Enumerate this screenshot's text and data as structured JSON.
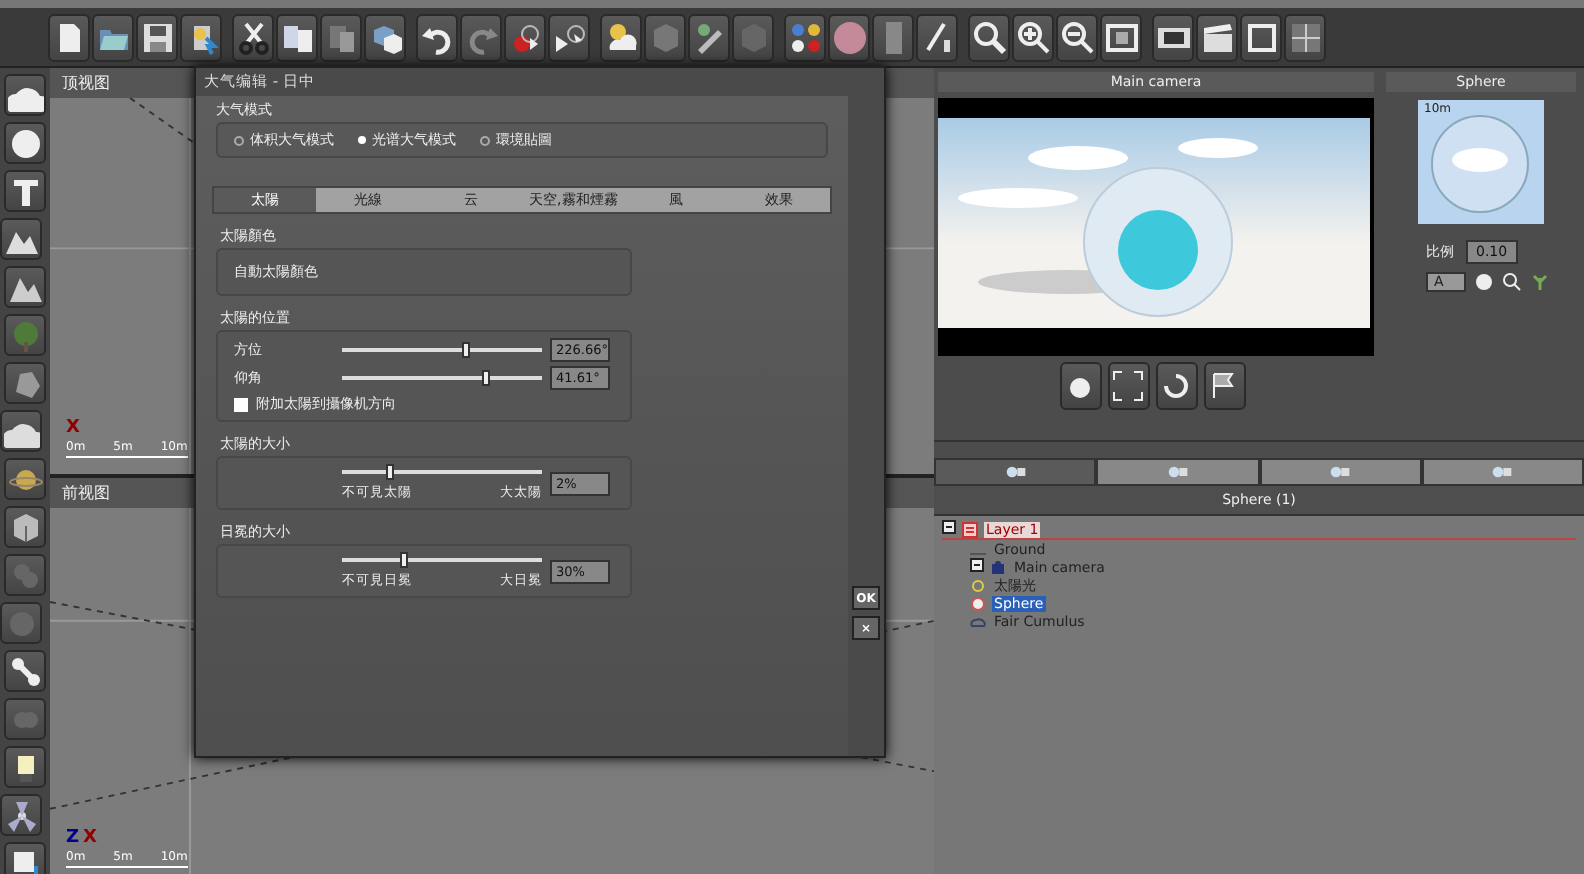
{
  "viewports": [
    {
      "title": "顶视图",
      "axis_labels": [
        "X"
      ],
      "scale": [
        "0m",
        "5m",
        "10m"
      ]
    },
    {
      "title": "前视图",
      "axis_labels": [
        "Z",
        "X"
      ],
      "scale": [
        "0m",
        "5m",
        "10m"
      ]
    }
  ],
  "dialog": {
    "title": "大气编辑 - 日中",
    "mode_group": {
      "label": "大气模式",
      "options": [
        {
          "label": "体积大气模式",
          "selected": false
        },
        {
          "label": "光谱大气模式",
          "selected": true
        },
        {
          "label": "環境貼圖",
          "selected": false
        }
      ]
    },
    "tabs": [
      {
        "label": "太陽",
        "selected": true
      },
      {
        "label": "光線",
        "selected": false
      },
      {
        "label": "云",
        "selected": false
      },
      {
        "label": "天空,霧和煙霧",
        "selected": false
      },
      {
        "label": "風",
        "selected": false
      },
      {
        "label": "效果",
        "selected": false
      }
    ],
    "sun_color": {
      "label": "太陽顏色",
      "value": "自動太陽顏色"
    },
    "sun_position": {
      "label": "太陽的位置",
      "sliders": [
        {
          "label": "方位",
          "level": 0.62,
          "reading": "226.66°"
        },
        {
          "label": "仰角",
          "level": 0.73,
          "reading": "41.61°"
        }
      ],
      "attach": {
        "label": "附加太陽到攝像机方向",
        "checked": false
      }
    },
    "size_groups": [
      {
        "label": "太陽的大小",
        "level": 0.23,
        "min_label": "不可見太陽",
        "max_label": "大太陽",
        "reading": "2%"
      },
      {
        "label": "日冕的大小",
        "level": 0.3,
        "min_label": "不可見日冕",
        "max_label": "大日冕",
        "reading": "30%"
      }
    ],
    "buttons": [
      "OK",
      "×"
    ]
  },
  "camera_view": {
    "title": "Main camera"
  },
  "object_panel": {
    "title": "Sphere",
    "preview_label": "10m",
    "scale_label": "比例",
    "scale_value": "0.10",
    "material_layer": "A"
  },
  "world_browser": {
    "title": "Sphere (1)",
    "tabs": [
      {
        "selected": true
      },
      {
        "selected": false
      },
      {
        "selected": false
      },
      {
        "selected": false
      }
    ],
    "tree": [
      {
        "label": "Layer 1",
        "expanded": true,
        "selected": false,
        "children": [
          {
            "label": "Ground",
            "kind": "ground",
            "selected": false
          },
          {
            "label": "Main camera",
            "kind": "camera",
            "expanded": true,
            "selected": false
          },
          {
            "label": "太陽光",
            "kind": "light",
            "selected": false
          },
          {
            "label": "Sphere",
            "kind": "sphere",
            "selected": true
          },
          {
            "label": "Fair Cumulus",
            "kind": "cloud",
            "selected": false
          }
        ]
      }
    ]
  }
}
